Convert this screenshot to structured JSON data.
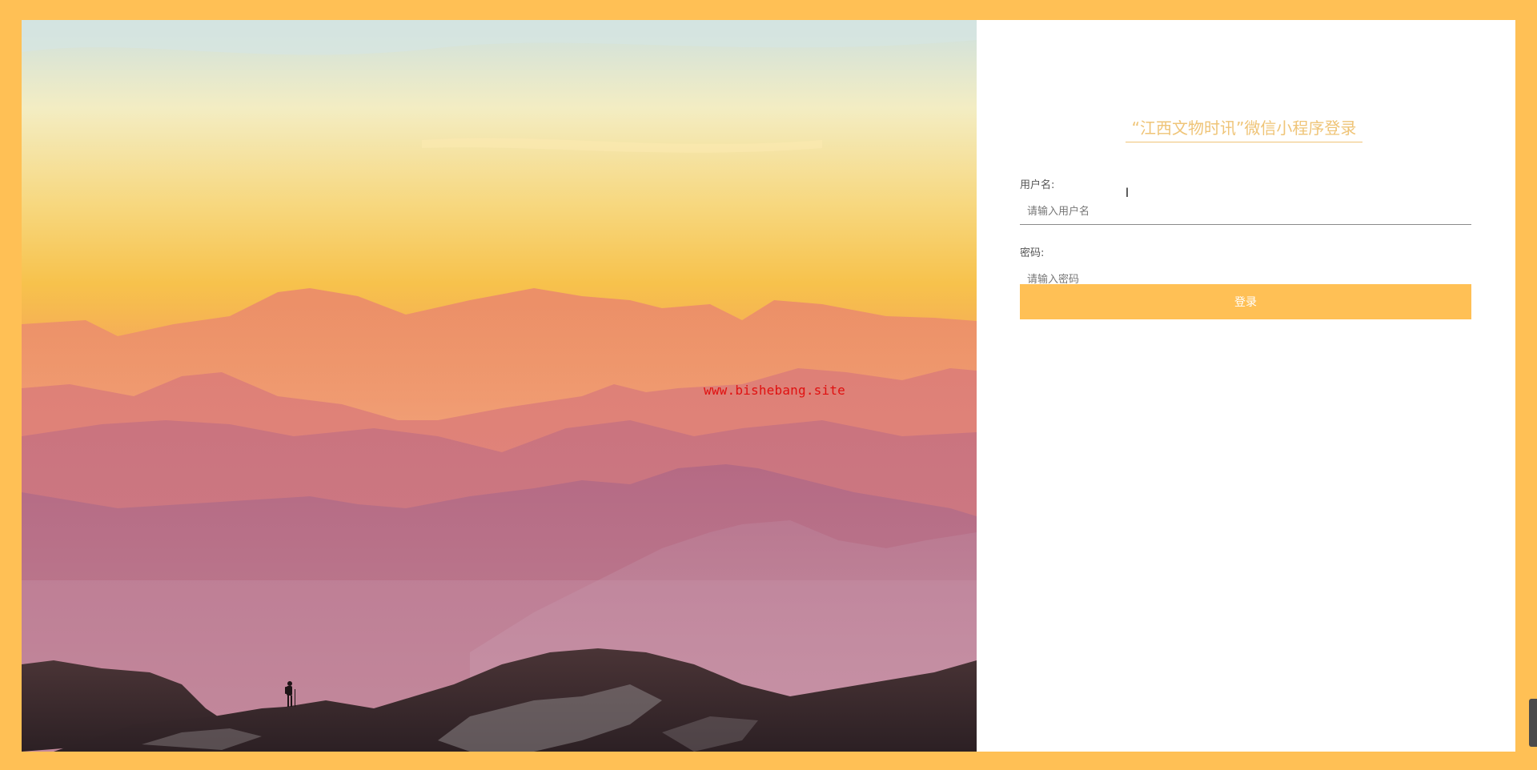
{
  "login": {
    "title": "“江西文物时讯”微信小程序登录",
    "username_label": "用户名:",
    "username_placeholder": "请输入用户名",
    "password_label": "密码:",
    "password_placeholder": "请输入密码",
    "submit_label": "登录"
  },
  "watermark": "www.bishebang.site",
  "colors": {
    "page_background": "#ffc055",
    "accent": "#ffc055",
    "title": "#efc477",
    "watermark": "#e01010"
  },
  "icons": {
    "cursor": "text-cursor-icon"
  }
}
